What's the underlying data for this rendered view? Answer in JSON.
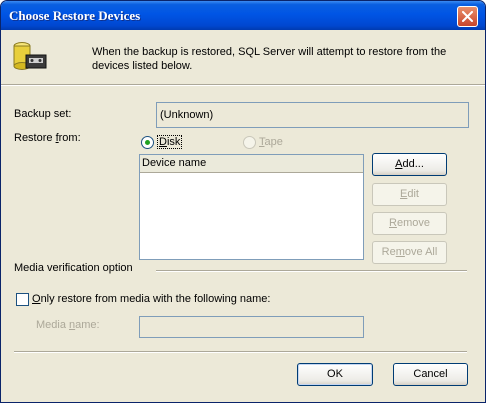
{
  "window": {
    "title": "Choose Restore Devices"
  },
  "icons": {
    "header_icon": "database-tape-icon",
    "close": "close-icon"
  },
  "colors": {
    "title_bar": "#0055e5",
    "close_button": "#c8452b",
    "dialog_bg": "#ece9d8",
    "radio_dot": "#21a121"
  },
  "info": {
    "text": "When the backup is restored, SQL Server will attempt to restore from the devices listed below."
  },
  "backup_set": {
    "label": "Backup set:",
    "value": "(Unknown)"
  },
  "restore_from": {
    "label": "Restore from:",
    "options": [
      {
        "label": "Disk",
        "selected": true,
        "enabled": true
      },
      {
        "label": "Tape",
        "selected": false,
        "enabled": false
      }
    ]
  },
  "device_list": {
    "column_header": "Device name",
    "items": []
  },
  "buttons": {
    "add": "Add...",
    "edit": "Edit",
    "remove": "Remove",
    "remove_all": "Remove All",
    "ok": "OK",
    "cancel": "Cancel"
  },
  "media_verification": {
    "label": "Media verification option",
    "checkbox_label": "Only restore from media with the following name:",
    "checked": false,
    "media_name_label": "Media name:",
    "media_name_value": ""
  }
}
